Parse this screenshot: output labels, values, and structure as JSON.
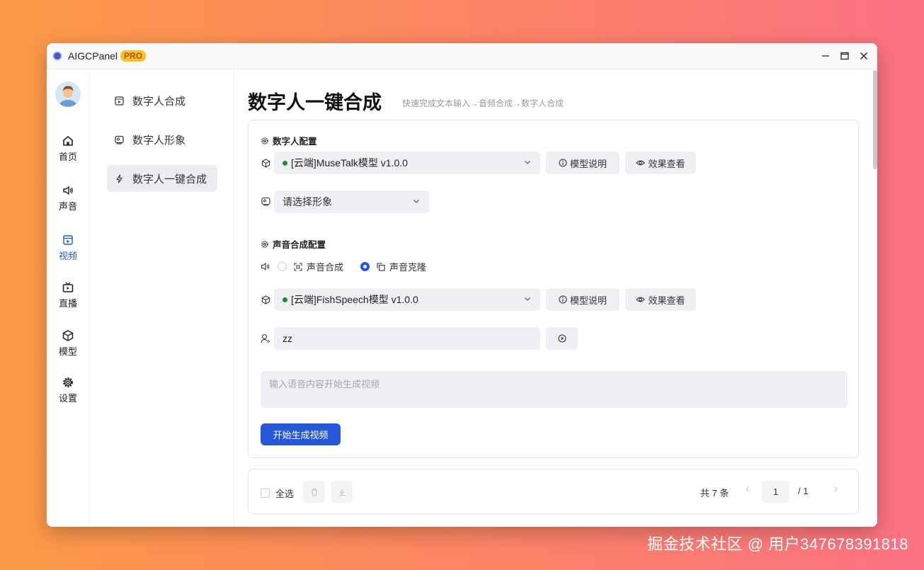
{
  "window": {
    "title": "AIGCPanel",
    "badge": "PRO"
  },
  "rail": {
    "items": [
      {
        "label": "首页",
        "icon": "home-icon"
      },
      {
        "label": "声音",
        "icon": "speaker-icon"
      },
      {
        "label": "视频",
        "icon": "video-icon"
      },
      {
        "label": "直播",
        "icon": "tv-icon"
      },
      {
        "label": "模型",
        "icon": "cube-icon"
      },
      {
        "label": "设置",
        "icon": "gear-icon"
      }
    ],
    "active": "视频"
  },
  "subnav": {
    "items": [
      {
        "label": "数字人合成",
        "icon": "video-frame-icon"
      },
      {
        "label": "数字人形象",
        "icon": "portrait-icon"
      },
      {
        "label": "数字人一键合成",
        "icon": "lightning-icon"
      }
    ],
    "active": "数字人一键合成"
  },
  "page": {
    "title": "数字人一键合成",
    "subtitle": "快速完成文本输入→音频合成→数字人合成"
  },
  "digital_human": {
    "section_title": "数字人配置",
    "model_select": "[云端]MuseTalk模型 v1.0.0",
    "model_info_label": "模型说明",
    "effect_view_label": "效果查看",
    "avatar_select_placeholder": "请选择形象"
  },
  "voice": {
    "section_title": "声音合成配置",
    "option_synthesis": "声音合成",
    "option_clone": "声音克隆",
    "selected_option": "声音克隆",
    "model_select": "[云端]FishSpeech模型 v1.0.0",
    "model_info_label": "模型说明",
    "effect_view_label": "效果查看",
    "speaker_value": "zz"
  },
  "content": {
    "textarea_placeholder": "输入语音内容开始生成视频",
    "generate_button": "开始生成视频"
  },
  "list_bar": {
    "select_all": "全选",
    "total": "共 7 条",
    "current_page": "1",
    "page_sep": "/ 1"
  },
  "watermark": "掘金技术社区 @ 用户347678391818",
  "colors": {
    "accent": "#2557d6",
    "status_green": "#1f8a3b",
    "badge_bg": "#f8c12c"
  }
}
